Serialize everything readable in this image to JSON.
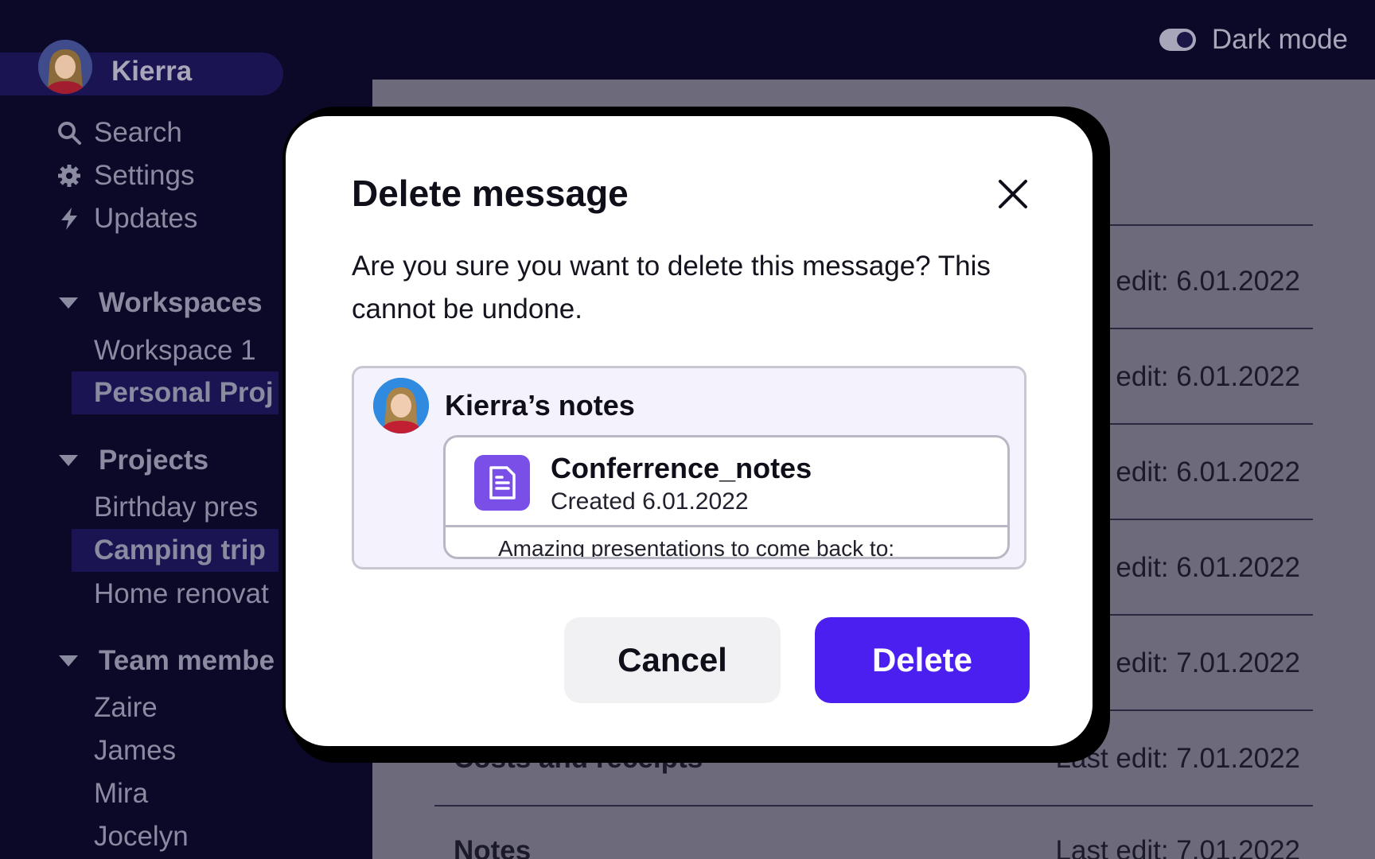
{
  "header": {
    "dark_mode_label": "Dark mode"
  },
  "sidebar": {
    "user_name": "Kierra",
    "nav": [
      {
        "label": "Search",
        "icon": "search-icon"
      },
      {
        "label": "Settings",
        "icon": "gear-icon"
      },
      {
        "label": "Updates",
        "icon": "lightning-icon"
      }
    ],
    "workspaces": {
      "label": "Workspaces",
      "items": [
        "Workspace 1",
        "Personal Proj"
      ]
    },
    "projects": {
      "label": "Projects",
      "items": [
        "Birthday pres",
        "Camping trip",
        "Home renovat"
      ]
    },
    "team": {
      "label": "Team membe",
      "items": [
        "Zaire",
        "James",
        "Mira",
        "Jocelyn"
      ]
    }
  },
  "main": {
    "rows": [
      {
        "title": "",
        "edit": "edit: 6.01.2022"
      },
      {
        "title": "",
        "edit": "edit: 6.01.2022"
      },
      {
        "title": "",
        "edit": "edit: 6.01.2022"
      },
      {
        "title": "",
        "edit": "edit: 6.01.2022"
      },
      {
        "title": "",
        "edit": "edit: 7.01.2022"
      },
      {
        "title": "Costs and receipts",
        "edit": "Last edit: 7.01.2022"
      },
      {
        "title": "Notes",
        "edit": "Last edit: 7.01.2022"
      }
    ]
  },
  "modal": {
    "title": "Delete message",
    "body": "Are you sure you want to delete this message? This cannot be undone.",
    "preview": {
      "author": "Kierra’s notes",
      "file_name": "Conferrence_notes",
      "file_date": "Created 6.01.2022",
      "snippet": "Amazing presentations to come back to:"
    },
    "cancel_label": "Cancel",
    "delete_label": "Delete"
  },
  "colors": {
    "accent": "#4a1ff0",
    "file_icon": "#7a4fe8",
    "background": "#0b0828",
    "dim_panel": "#6d6b7b"
  }
}
